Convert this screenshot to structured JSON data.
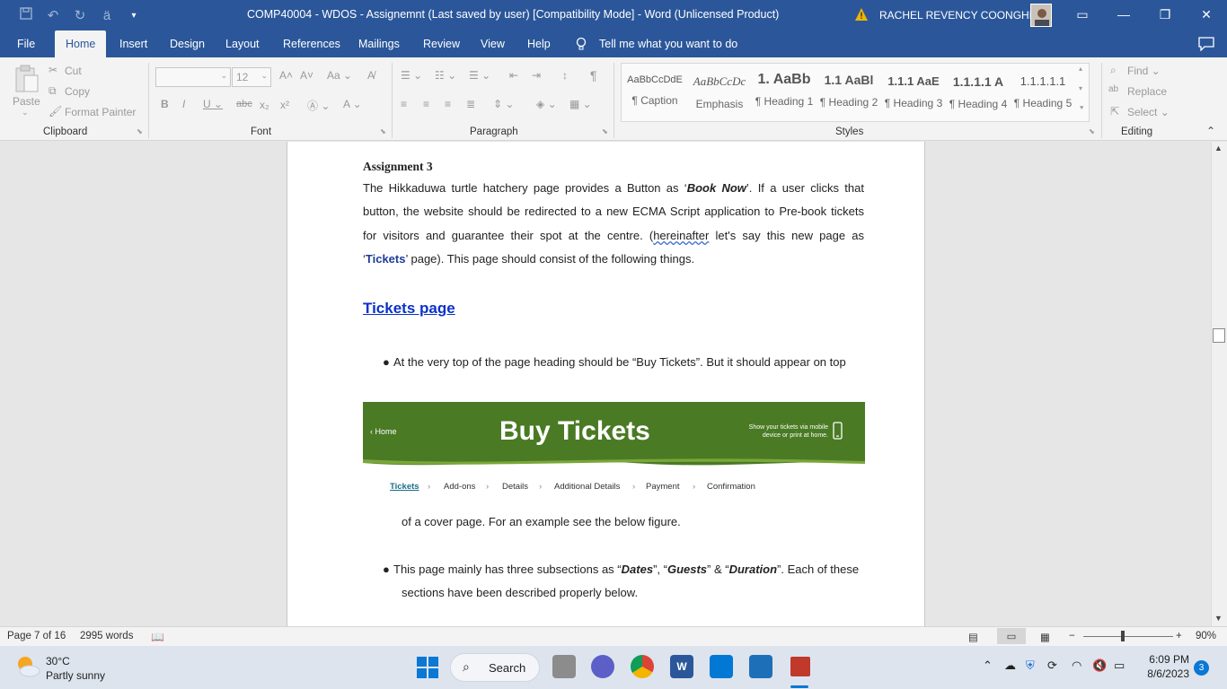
{
  "titlebar": {
    "doc_title": "COMP40004 - WDOS - Assignemnt (Last saved by user) [Compatibility Mode]  -  Word (Unlicensed Product)",
    "user_name": "RACHEL REVENCY COONGHE",
    "qat_icons": [
      "save-icon",
      "undo-icon",
      "redo-icon",
      "customize-icon"
    ]
  },
  "menu": {
    "tabs": [
      "File",
      "Home",
      "Insert",
      "Design",
      "Layout",
      "References",
      "Mailings",
      "Review",
      "View",
      "Help"
    ],
    "active": "Home",
    "tell_me": "Tell me what you want to do"
  },
  "ribbon": {
    "clipboard": {
      "paste": "Paste",
      "cut": "Cut",
      "copy": "Copy",
      "format_painter": "Format Painter",
      "label": "Clipboard"
    },
    "font": {
      "size": "12",
      "label": "Font"
    },
    "paragraph": {
      "label": "Paragraph"
    },
    "styles": {
      "label": "Styles",
      "items": [
        {
          "preview": "AaBbCcDdE",
          "name": "¶ Caption"
        },
        {
          "preview": "AaBbCcDc",
          "name": "Emphasis"
        },
        {
          "preview": "1. AaBb",
          "name": "¶ Heading 1"
        },
        {
          "preview": "1.1  AaBl",
          "name": "¶ Heading 2"
        },
        {
          "preview": "1.1.1  AaE",
          "name": "¶ Heading 3"
        },
        {
          "preview": "1.1.1.1  A",
          "name": "¶ Heading 4"
        },
        {
          "preview": "1.1.1.1.1",
          "name": "¶ Heading 5"
        }
      ]
    },
    "editing": {
      "find": "Find",
      "replace": "Replace",
      "select": "Select",
      "label": "Editing"
    }
  },
  "document": {
    "heading": "Assignment 3",
    "para1_a": "The Hikkaduwa turtle hatchery page provides a Button as ‘",
    "para1_bold": "Book Now",
    "para1_b": "’. If a user clicks that",
    "para1_line2": "button, the website should be redirected to a new ECMA Script application to Pre-book tickets",
    "para1_line3_a": "for visitors and guarantee their spot at the centre. (",
    "para1_line3_word": "hereinafter",
    "para1_line3_b": " let's say this new page as",
    "para1_line4_a": "‘",
    "para1_line4_bold": "Tickets",
    "para1_line4_b": "’ page). This page should consist of the following things.",
    "section_title": "Tickets page",
    "bullet1": "At the very top of the page heading should be “Buy Tickets”. But it should appear on top",
    "bullet1_cont": "of a cover page. For an example see the below figure.",
    "bullet2_a": "This page mainly has three subsections as “",
    "bullet2_dates": "Dates",
    "bullet2_mid1": "”, “",
    "bullet2_guests": "Guests",
    "bullet2_mid2": "” & “",
    "bullet2_duration": "Duration",
    "bullet2_b": "”. Each of these",
    "bullet2_cont": "sections have been described properly below.",
    "figure": {
      "home": "‹ Home",
      "title": "Buy Tickets",
      "note": "Show your tickets via mobile device or print at home.",
      "steps": [
        "Tickets",
        "Add-ons",
        "Details",
        "Additional Details",
        "Payment",
        "Confirmation"
      ],
      "active_color": "#1a6e8a"
    }
  },
  "status": {
    "page": "Page 7 of 16",
    "words": "2995 words",
    "zoom": "90%"
  },
  "taskbar": {
    "temp": "30°C",
    "weather": "Partly sunny",
    "search": "Search",
    "time": "6:09 PM",
    "date": "8/6/2023",
    "notifications": "3"
  },
  "colors": {
    "word_blue": "#2b579a",
    "link_blue": "#0a32c8",
    "banner_green": "#4a7a24"
  }
}
